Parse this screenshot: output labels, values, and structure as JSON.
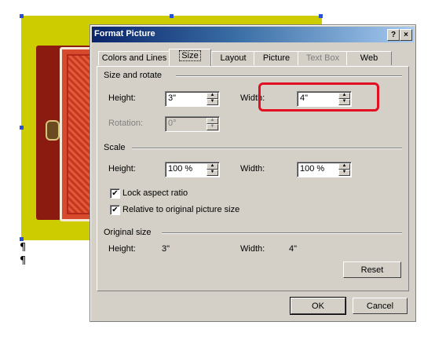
{
  "document": {
    "pilcrows": [
      "¶",
      "¶"
    ]
  },
  "dialog": {
    "title": "Format Picture",
    "help_button": "?",
    "close_button": "×",
    "tabs": [
      {
        "label": "Colors and Lines",
        "state": "normal"
      },
      {
        "label": "Size",
        "state": "active"
      },
      {
        "label": "Layout",
        "state": "normal"
      },
      {
        "label": "Picture",
        "state": "normal"
      },
      {
        "label": "Text Box",
        "state": "disabled"
      },
      {
        "label": "Web",
        "state": "normal"
      }
    ],
    "size_and_rotate": {
      "group_label": "Size and rotate",
      "height_label": "Height:",
      "height_value": "3\"",
      "width_label": "Width:",
      "width_value": "4\"",
      "rotation_label": "Rotation:",
      "rotation_value": "0°"
    },
    "scale": {
      "group_label": "Scale",
      "height_label": "Height:",
      "height_value": "100 %",
      "width_label": "Width:",
      "width_value": "100 %",
      "lock_aspect_label": "Lock aspect ratio",
      "lock_aspect_checked": true,
      "relative_label": "Relative to original picture size",
      "relative_checked": true
    },
    "original_size": {
      "group_label": "Original size",
      "height_label": "Height:",
      "height_value": "3\"",
      "width_label": "Width:",
      "width_value": "4\"",
      "reset_button": "Reset"
    },
    "ok_button": "OK",
    "cancel_button": "Cancel",
    "highlight_color": "#e01020",
    "title_gradient": [
      "#0a246a",
      "#a6caf0"
    ]
  }
}
